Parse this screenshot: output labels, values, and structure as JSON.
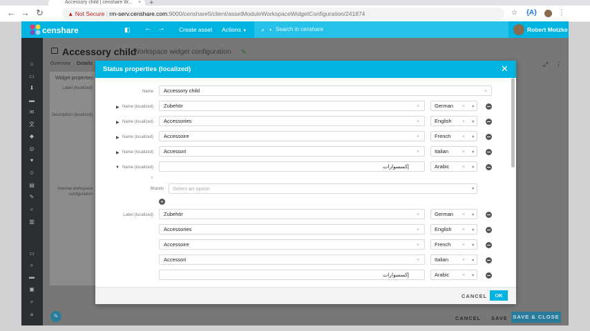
{
  "browser": {
    "tab_title": "Accessory child | censhare W...",
    "not_secure": "Not Secure",
    "url_host": "rm-serv.censhare.com",
    "url_path": ":9000/censhare5/client/assetModuleWorkspaceWidgetConfiguration/241874"
  },
  "app": {
    "brand": "censhare",
    "create_asset": "Create asset",
    "actions": "Actions",
    "search_placeholder": "Search in censhare",
    "user_name": "Robert Motzke"
  },
  "page": {
    "title": "Accessory child",
    "subtitle": "Workspace widget configuration",
    "tabs": [
      "Overview",
      "Details"
    ],
    "panel_title": "Widget properties",
    "panel_labels": [
      "Label (localized)",
      "Description (localized)",
      "Internal workspace configuration"
    ],
    "footer": {
      "cancel": "CANCEL",
      "save": "SAVE",
      "save_close": "SAVE & CLOSE"
    }
  },
  "modal": {
    "title": "Status properties (localized)",
    "name_label": "Name",
    "name_value": "Accessory child",
    "name_localized_label": "Name (localized)",
    "name_localized": [
      {
        "value": "Zubehör",
        "language": "German"
      },
      {
        "value": "Accessories",
        "language": "English"
      },
      {
        "value": "Accessoire",
        "language": "French"
      },
      {
        "value": "Accessori",
        "language": "Italian"
      },
      {
        "value": "إكسسوارات",
        "language": "Arabic"
      }
    ],
    "brands_label": "Brands",
    "brands_placeholder": "Select an option",
    "label_localized_label": "Label (localized)",
    "label_localized": [
      {
        "value": "Zubehör",
        "language": "German"
      },
      {
        "value": "Accessories",
        "language": "English"
      },
      {
        "value": "Accessoire",
        "language": "French"
      },
      {
        "value": "Accessori",
        "language": "Italian"
      },
      {
        "value": "إكسسوارات",
        "language": "Arabic"
      }
    ],
    "cancel": "CANCEL",
    "ok": "OK"
  }
}
